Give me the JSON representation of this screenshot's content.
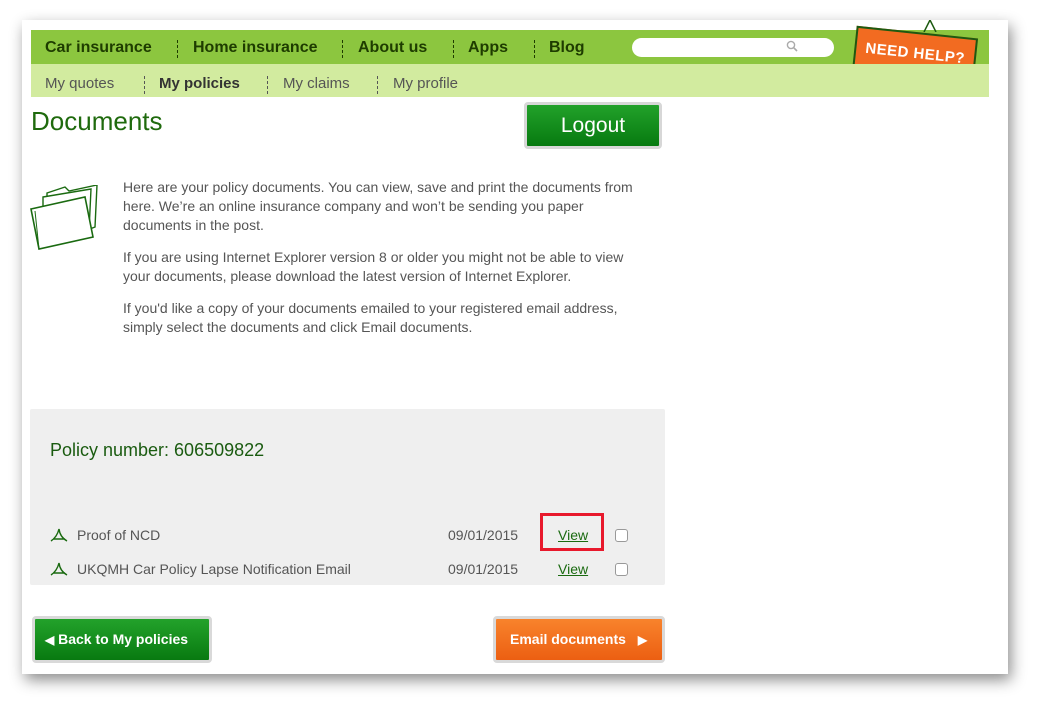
{
  "nav": {
    "main": [
      "Car insurance",
      "Home insurance",
      "About us",
      "Apps",
      "Blog"
    ],
    "sub": [
      "My quotes",
      "My policies",
      "My claims",
      "My profile"
    ],
    "active_sub": "My policies",
    "search": {
      "placeholder": ""
    },
    "need_help": "NEED HELP?"
  },
  "page": {
    "title": "Documents",
    "logout": "Logout",
    "intro": [
      "Here are your policy documents. You can view, save and print the documents from here. We’re an online insurance company and won’t be sending you paper documents in the post.",
      "If you are using Internet Explorer version 8 or older you might not be able to view your documents, please download the latest version of Internet Explorer.",
      "If you'd like a copy of your documents emailed to your registered email address, simply select the documents and click Email documents."
    ]
  },
  "policy": {
    "label": "Policy number: 606509822",
    "documents": [
      {
        "name": "Proof of NCD",
        "date": "09/01/2015",
        "action": "View"
      },
      {
        "name": "UKQMH Car Policy Lapse Notification Email",
        "date": "09/01/2015",
        "action": "View"
      }
    ]
  },
  "buttons": {
    "back": "Back to My policies",
    "email": "Email documents"
  },
  "colors": {
    "brand_green": "#8cc63f",
    "light_green": "#d2eb9f",
    "dark_green": "#077a10",
    "orange": "#f26b21",
    "highlight_red": "#e8192c"
  },
  "icons": {
    "search": "magnifier",
    "folder": "folder-outline",
    "pdf": "pdf-acrobat",
    "back_arrow": "triangle-left",
    "email_arrow": "triangle-right"
  }
}
